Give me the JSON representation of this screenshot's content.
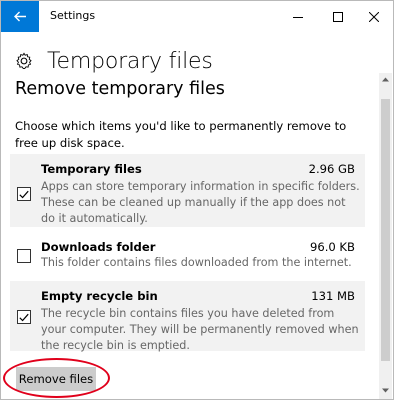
{
  "window": {
    "title": "Settings",
    "controls": [
      "minimize-icon",
      "maximize-icon",
      "close-icon"
    ],
    "accent_color": "#0078d7"
  },
  "header": {
    "icon": "gear-icon",
    "title": "Temporary files"
  },
  "section": {
    "title": "Remove temporary files",
    "description": "Choose which items you'd like to permanently remove to free up disk space."
  },
  "items": [
    {
      "name": "Temporary files",
      "size": "2.96 GB",
      "checked": true,
      "description": "Apps can store temporary information in specific folders. These can be cleaned up manually if the app does not do it automatically."
    },
    {
      "name": "Downloads folder",
      "size": "96.0 KB",
      "checked": false,
      "description": "This folder contains files downloaded from the internet."
    },
    {
      "name": "Empty recycle bin",
      "size": "131 MB",
      "checked": true,
      "description": "The recycle bin contains files you have deleted from your computer. They will be permanently removed when the recycle bin is emptied."
    }
  ],
  "actions": {
    "remove_label": "Remove files"
  },
  "annotation": {
    "highlight_color": "#e0001b"
  }
}
